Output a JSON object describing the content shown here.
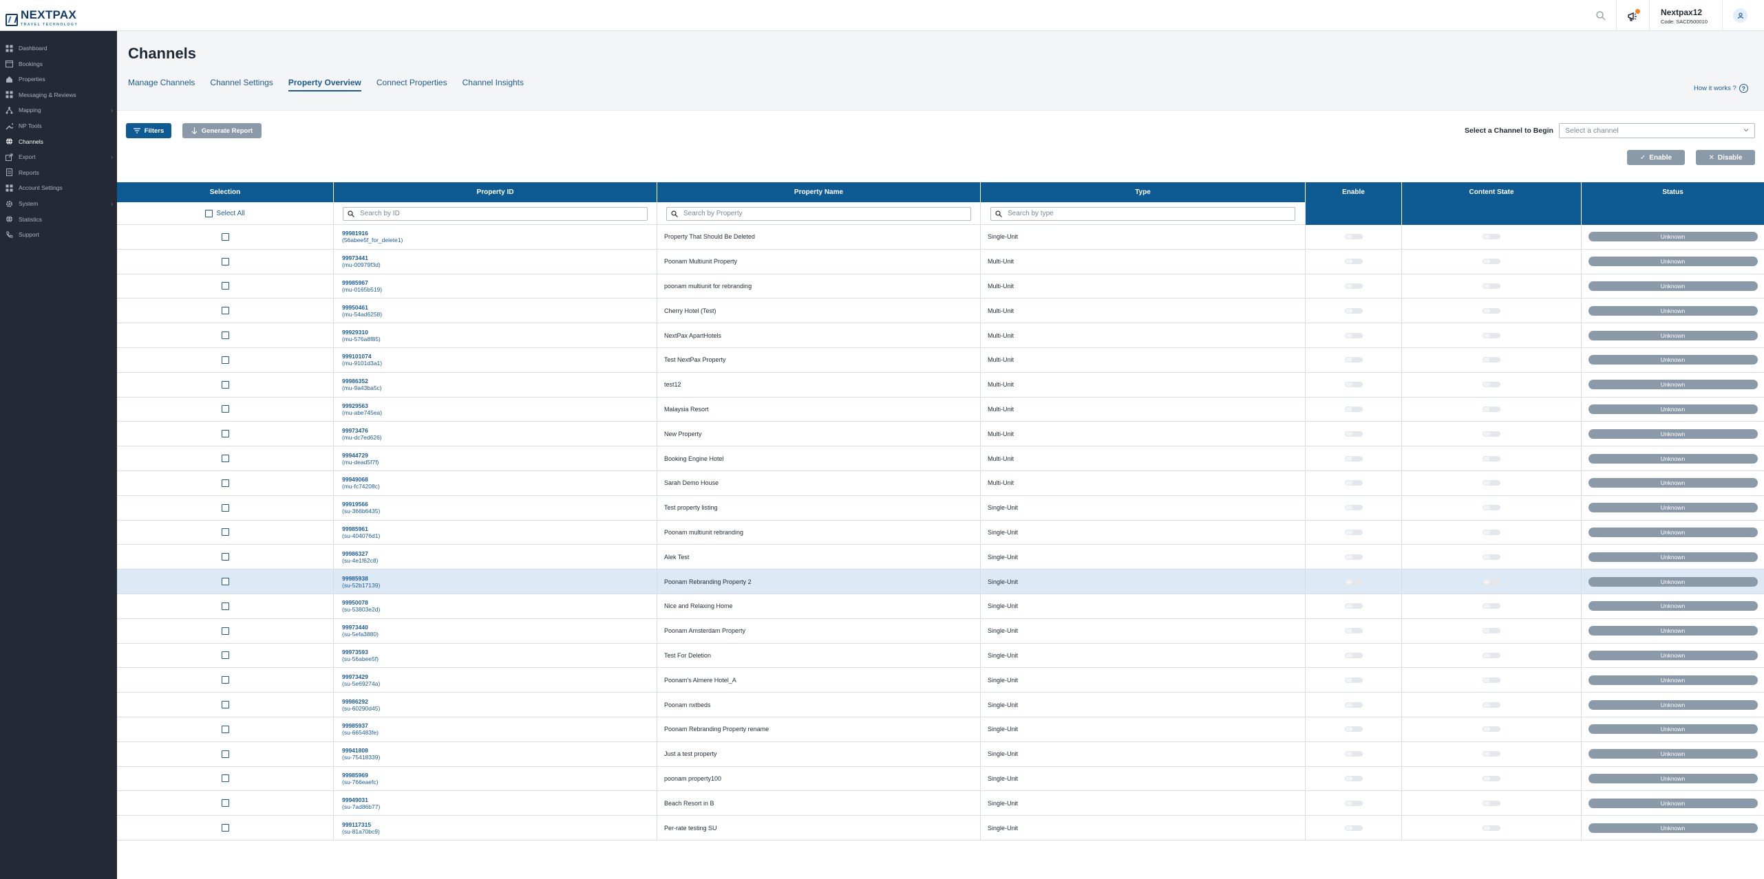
{
  "brand": {
    "name": "NEXTPAX",
    "tagline": "TRAVEL TECHNOLOGY"
  },
  "account": {
    "name": "Nextpax12",
    "code": "Code: SACD500010"
  },
  "sidebar": {
    "items": [
      {
        "label": "Dashboard",
        "icon": "grid-icon",
        "active": false,
        "chevron": false
      },
      {
        "label": "Bookings",
        "icon": "calendar-icon",
        "active": false,
        "chevron": false
      },
      {
        "label": "Properties",
        "icon": "home-icon",
        "active": false,
        "chevron": false
      },
      {
        "label": "Messaging & Reviews",
        "icon": "grid-icon",
        "active": false,
        "chevron": false
      },
      {
        "label": "Mapping",
        "icon": "mapping-icon",
        "active": false,
        "chevron": true
      },
      {
        "label": "NP Tools",
        "icon": "wrench-icon",
        "active": false,
        "chevron": false
      },
      {
        "label": "Channels",
        "icon": "globe-icon",
        "active": true,
        "chevron": false
      },
      {
        "label": "Export",
        "icon": "export-icon",
        "active": false,
        "chevron": true
      },
      {
        "label": "Reports",
        "icon": "report-icon",
        "active": false,
        "chevron": false
      },
      {
        "label": "Account Settings",
        "icon": "grid-icon",
        "active": false,
        "chevron": false
      },
      {
        "label": "System",
        "icon": "gear-icon",
        "active": false,
        "chevron": true
      },
      {
        "label": "Statistics",
        "icon": "globe-icon",
        "active": false,
        "chevron": false
      },
      {
        "label": "Support",
        "icon": "phone-icon",
        "active": false,
        "chevron": false
      }
    ]
  },
  "page": {
    "title": "Channels",
    "tabs": [
      {
        "label": "Manage Channels",
        "active": false
      },
      {
        "label": "Channel Settings",
        "active": false
      },
      {
        "label": "Property Overview",
        "active": true
      },
      {
        "label": "Connect Properties",
        "active": false
      },
      {
        "label": "Channel Insights",
        "active": false
      }
    ],
    "how_it_works": "How it works ?"
  },
  "toolbar": {
    "filters_label": "Filters",
    "report_label": "Generate Report",
    "select_label": "Select a Channel to Begin",
    "select_placeholder": "Select a channel",
    "enable_label": "Enable",
    "disable_label": "Disable"
  },
  "table": {
    "columns": [
      "Selection",
      "Property ID",
      "Property Name",
      "Type",
      "Enable",
      "Content State",
      "Status"
    ],
    "select_all": "Select All",
    "search_id": "Search by ID",
    "search_property": "Search by Property",
    "search_type": "Search by type",
    "rows": [
      {
        "id": "99981916",
        "sub": "(56abee5f_for_delete1)",
        "name": "Property That Should Be Deleted",
        "type": "Single-Unit",
        "status": "Unknown"
      },
      {
        "id": "99973441",
        "sub": "(mu-00979f3d)",
        "name": "Poonam Multiunit Property",
        "type": "Multi-Unit",
        "status": "Unknown"
      },
      {
        "id": "99985967",
        "sub": "(mu-0165b519)",
        "name": "poonam multiunit for rebranding",
        "type": "Multi-Unit",
        "status": "Unknown"
      },
      {
        "id": "99950461",
        "sub": "(mu-54ad6258)",
        "name": "Cherry Hotel (Test)",
        "type": "Multi-Unit",
        "status": "Unknown"
      },
      {
        "id": "99929310",
        "sub": "(mu-576a8f85)",
        "name": "NextPax ApartHotels",
        "type": "Multi-Unit",
        "status": "Unknown"
      },
      {
        "id": "999101074",
        "sub": "(mu-9101d3a1)",
        "name": "Test NextPax Property",
        "type": "Multi-Unit",
        "status": "Unknown"
      },
      {
        "id": "99986352",
        "sub": "(mu-9a43ba5c)",
        "name": "test12",
        "type": "Multi-Unit",
        "status": "Unknown"
      },
      {
        "id": "99929563",
        "sub": "(mu-abe745ea)",
        "name": "Malaysia Resort",
        "type": "Multi-Unit",
        "status": "Unknown"
      },
      {
        "id": "99973476",
        "sub": "(mu-dc7ed626)",
        "name": "New Property",
        "type": "Multi-Unit",
        "status": "Unknown"
      },
      {
        "id": "99944729",
        "sub": "(mu-dead5f7f)",
        "name": "Booking Engine Hotel",
        "type": "Multi-Unit",
        "status": "Unknown"
      },
      {
        "id": "99949068",
        "sub": "(mu-fc74208c)",
        "name": "Sarah Demo House",
        "type": "Multi-Unit",
        "status": "Unknown"
      },
      {
        "id": "99919566",
        "sub": "(su-366b6435)",
        "name": "Test property listing",
        "type": "Single-Unit",
        "status": "Unknown"
      },
      {
        "id": "99985961",
        "sub": "(su-404076d1)",
        "name": "Poonam multiunit rebranding",
        "type": "Single-Unit",
        "status": "Unknown"
      },
      {
        "id": "99986327",
        "sub": "(su-4e1f62c8)",
        "name": "Alek Test",
        "type": "Single-Unit",
        "status": "Unknown"
      },
      {
        "id": "99985938",
        "sub": "(su-52b17139)",
        "name": "Poonam Rebranding Property 2",
        "type": "Single-Unit",
        "status": "Unknown"
      },
      {
        "id": "99950078",
        "sub": "(su-53803e2d)",
        "name": "Nice and Relaxing Home",
        "type": "Single-Unit",
        "status": "Unknown"
      },
      {
        "id": "99973440",
        "sub": "(su-5efa3880)",
        "name": "Poonam Amsterdam Property",
        "type": "Single-Unit",
        "status": "Unknown"
      },
      {
        "id": "99973593",
        "sub": "(su-56abee5f)",
        "name": "Test For Deletion",
        "type": "Single-Unit",
        "status": "Unknown"
      },
      {
        "id": "99973429",
        "sub": "(su-5e69274a)",
        "name": "Poonam's Almere Hotel_A",
        "type": "Single-Unit",
        "status": "Unknown"
      },
      {
        "id": "99986292",
        "sub": "(su-60290d45)",
        "name": "Poonam nxtbeds",
        "type": "Single-Unit",
        "status": "Unknown"
      },
      {
        "id": "99985937",
        "sub": "(su-665483fe)",
        "name": "Poonam Rebranding Property rename",
        "type": "Single-Unit",
        "status": "Unknown"
      },
      {
        "id": "99941808",
        "sub": "(su-75418339)",
        "name": "Just a test property",
        "type": "Single-Unit",
        "status": "Unknown"
      },
      {
        "id": "99985969",
        "sub": "(su-766eaefc)",
        "name": "poonam property100",
        "type": "Single-Unit",
        "status": "Unknown"
      },
      {
        "id": "99949031",
        "sub": "(su-7ad86b77)",
        "name": "Beach Resort in B",
        "type": "Single-Unit",
        "status": "Unknown"
      },
      {
        "id": "999117315",
        "sub": "(su-81a70bc9)",
        "name": "Per-rate testing SU",
        "type": "Single-Unit",
        "status": "Unknown"
      }
    ],
    "highlight_row": 14
  },
  "colors": {
    "primary": "#0e5a92",
    "sidebar_bg": "#232a35",
    "disabled_btn": "#8b9aa8",
    "link": "#1b5a96",
    "notification": "#f5821f",
    "highlight_row": "#dde9f5"
  }
}
